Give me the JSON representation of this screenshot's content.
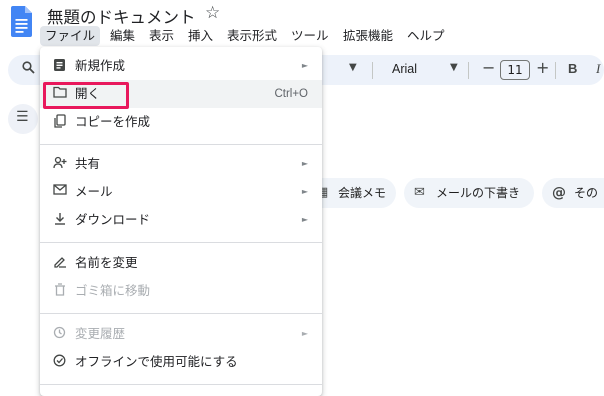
{
  "header": {
    "title": "無題のドキュメント",
    "star_icon": "star-outline-icon",
    "doc_icon": "google-docs-icon"
  },
  "menubar": {
    "items": [
      "ファイル",
      "編集",
      "表示",
      "挿入",
      "表示形式",
      "ツール",
      "拡張機能",
      "ヘルプ"
    ]
  },
  "toolbar": {
    "font": "Arial",
    "font_size": "11",
    "minus": "−",
    "plus": "+",
    "bold": "B",
    "italic": "I"
  },
  "chips": [
    {
      "icon": "calendar-icon",
      "label": "会議メモ"
    },
    {
      "icon": "email-draft-icon",
      "label": "メールの下書き"
    },
    {
      "icon": "at-sign-icon",
      "label": "その"
    }
  ],
  "file_menu": {
    "items": [
      {
        "label": "新規作成",
        "icon": "new-doc-icon",
        "submenu": true
      },
      {
        "label": "開く",
        "icon": "folder-icon",
        "shortcut": "Ctrl+O"
      },
      {
        "label": "コピーを作成",
        "icon": "copy-icon"
      },
      {
        "label": "共有",
        "icon": "person-add-icon",
        "submenu": true
      },
      {
        "label": "メール",
        "icon": "mail-icon",
        "submenu": true
      },
      {
        "label": "ダウンロード",
        "icon": "download-icon",
        "submenu": true
      },
      {
        "label": "名前を変更",
        "icon": "rename-icon"
      },
      {
        "label": "ゴミ箱に移動",
        "icon": "trash-icon",
        "disabled": true
      },
      {
        "label": "変更履歴",
        "icon": "history-icon",
        "submenu": true,
        "disabled": true
      },
      {
        "label": "オフラインで使用可能にする",
        "icon": "offline-icon"
      }
    ]
  },
  "colors": {
    "highlight": "#e8185c",
    "toolbar_bg": "#edf2fa",
    "doc_blue": "#4285f4"
  }
}
